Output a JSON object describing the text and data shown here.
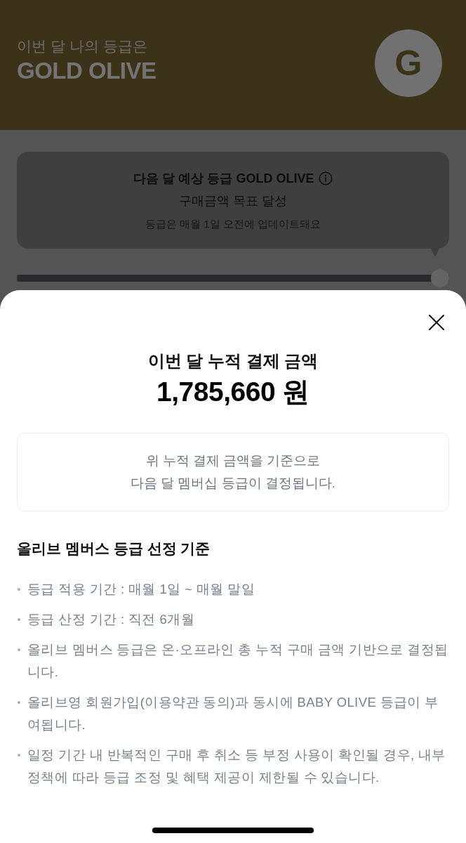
{
  "header": {
    "caption": "이번 달 나의 등급은",
    "grade": "GOLD OLIVE",
    "badge_letter": "G"
  },
  "forecast_card": {
    "headline": "다음 달 예상 등급 **GOLD OLIVE**",
    "status": "구매금액 목표 달성",
    "note": "등급은 매월 1일 오전에 업데이트돼요"
  },
  "progress": {
    "level": 1
  },
  "sheet": {
    "title": "이번 달 누적 결제 금액",
    "amount": "1,785,660 원",
    "notice": "위 누적 결제 금액을 기준으로\n다음 달 멤버십 등급이 결정됩니다.",
    "criteria": {
      "title": "올리브 멤버스 등급 선정 기준",
      "items": [
        "등급 적용 기간 : 매월 1일 ~ 매월 말일",
        "등급 산정 기간 : 직전 6개월",
        "올리브 멤버스 등급은 온·오프라인 총 누적 구매 금액 기반으로 결정됩니다.",
        "올리브영 회원가입(이용약관 동의)과 동시에 BABY OLIVE 등급이 부여됩니다.",
        "일정 기간 내 반복적인 구매 후 취소 등 부정 사용이 확인될 경우, 내부 정책에 따라 등급 조정 및 혜택 제공이 제한될 수 있습니다."
      ]
    }
  }
}
